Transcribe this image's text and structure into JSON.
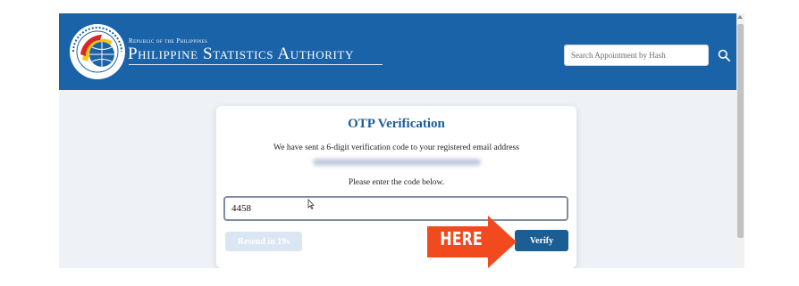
{
  "header": {
    "brand_subtitle": "Republic of the Philippines",
    "brand_title": "Philippine Statistics Authority",
    "logo": {
      "icon": "psa-seal-icon",
      "ring_text": "Philippine Statistics Authority"
    },
    "search": {
      "placeholder": "Search Appointment by Hash",
      "value": "",
      "icon": "search-icon"
    }
  },
  "otp_card": {
    "title": "OTP Verification",
    "message": "We have sent a 6-digit verification code to your registered email address",
    "email": "[blurred]",
    "prompt": "Please enter the code below.",
    "code_value": "4458",
    "resend_label": "Resend in 19s",
    "verify_label": "Verify"
  },
  "annotation": {
    "label": "HERE",
    "icon": "arrow-right-icon",
    "color": "#f04a1e"
  },
  "colors": {
    "header_blue": "#1b63a8",
    "button_blue": "#1b5e94",
    "page_bg": "#eef1f5"
  }
}
